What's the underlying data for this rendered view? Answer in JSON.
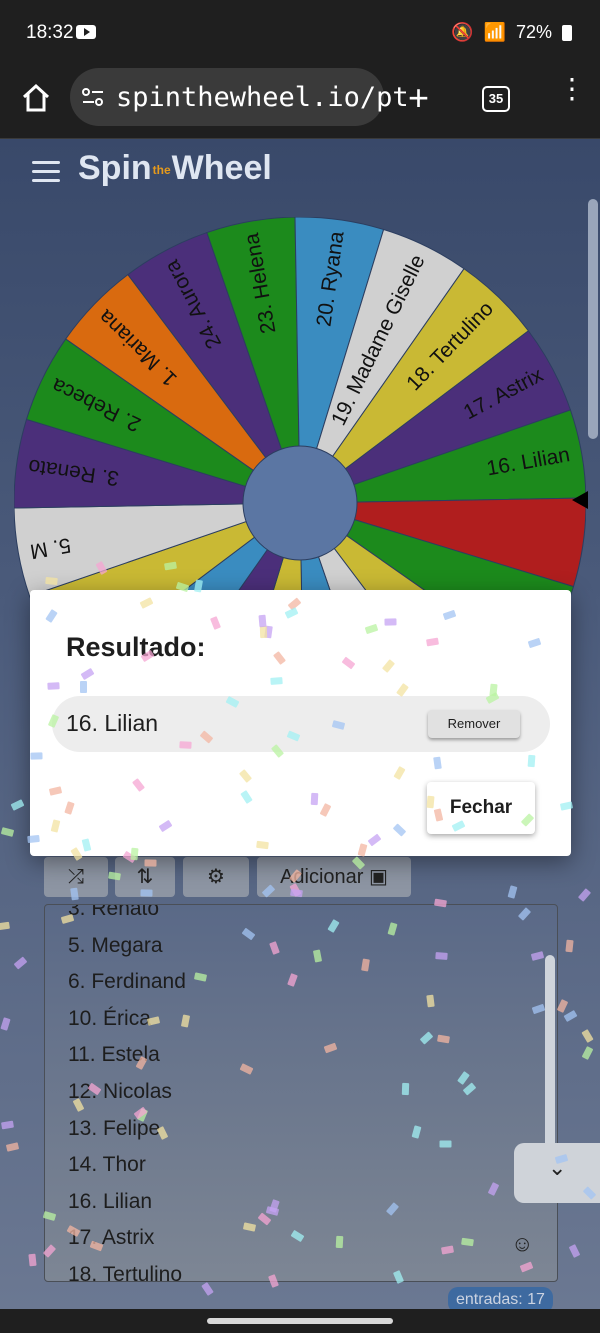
{
  "status": {
    "time": "18:32",
    "battery": "72%"
  },
  "browser": {
    "url": "spinthewheel.io/pt",
    "tab_count": "35"
  },
  "app": {
    "logo_left": "Spin",
    "logo_the": "the",
    "logo_right": "Wheel"
  },
  "wheel": {
    "segments": [
      {
        "label": "16. Lilian",
        "color": "#1c8a1c"
      },
      {
        "label": "",
        "color": "#b01e1e"
      },
      {
        "label": "",
        "color": "#1c8a1c"
      },
      {
        "label": "",
        "color": "#c9b934"
      },
      {
        "label": "",
        "color": "#d0d0d0"
      },
      {
        "label": "",
        "color": "#3a8cc0"
      },
      {
        "label": "",
        "color": "#c9b934"
      },
      {
        "label": "",
        "color": "#4b2f7a"
      },
      {
        "label": "",
        "color": "#3a8cc0"
      },
      {
        "label": "",
        "color": "#c9b934"
      },
      {
        "label": "5. M",
        "color": "#d0d0d0"
      },
      {
        "label": "3. Renato",
        "color": "#4b2f7a"
      },
      {
        "label": "2. Rebeca",
        "color": "#1c8a1c"
      },
      {
        "label": "1. Mariana",
        "color": "#d96a0f"
      },
      {
        "label": "24. Aurora",
        "color": "#4b2f7a"
      },
      {
        "label": "23. Helena",
        "color": "#1c8a1c"
      },
      {
        "label": "20. Ryana",
        "color": "#3a8cc0"
      },
      {
        "label": "19. Madame Giselle",
        "color": "#d0d0d0"
      },
      {
        "label": "18. Tertulino",
        "color": "#c9b934"
      },
      {
        "label": "17. Astrix",
        "color": "#4b2f7a"
      }
    ],
    "hub_color": "#5b76a3"
  },
  "toolbar": {
    "shuffle_icon": "shuffle-icon",
    "sort_icon": "sort-az-icon",
    "settings_icon": "settings-icon",
    "add_label": "Adicionar",
    "image_icon": "image-icon"
  },
  "entries_list": [
    "3. Renato",
    "5. Megara",
    "6. Ferdinand",
    "10. Érica",
    "11. Estela",
    "12. Nicolas",
    "13. Felipe",
    "14. Thor",
    "16. Lilian",
    "17. Astrix",
    "18. Tertulino"
  ],
  "entries_count": "entradas: 17",
  "modal": {
    "title": "Resultado:",
    "result": "16. Lilian",
    "remove_label": "Remover",
    "close_label": "Fechar"
  },
  "confetti_colors": [
    "#f5a6d3",
    "#a3c4f3",
    "#b9f3a1",
    "#f3e3a1",
    "#c5a3f3",
    "#f3b5a1",
    "#a1f0f3"
  ]
}
